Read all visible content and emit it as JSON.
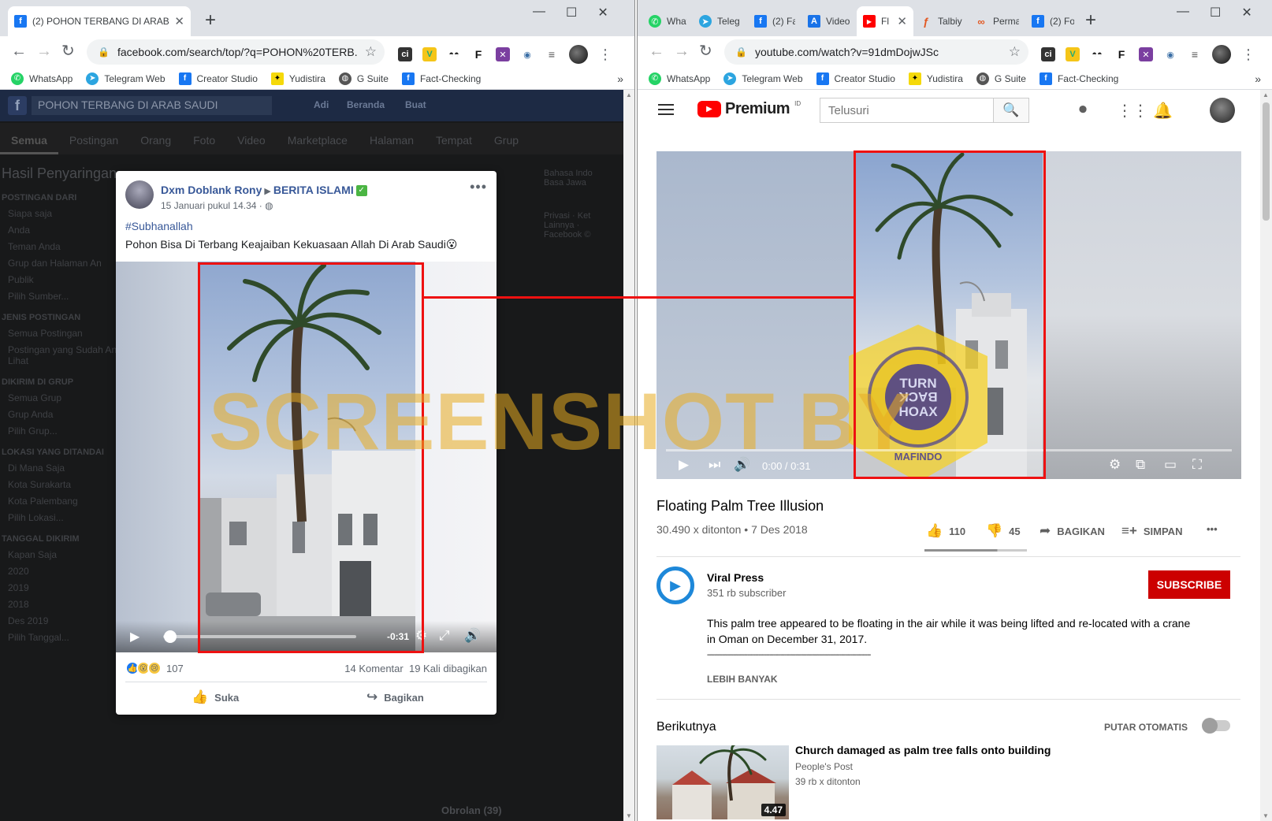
{
  "left_window": {
    "tab": {
      "title": "(2) POHON TERBANG DI ARAB SA"
    },
    "url": "facebook.com/search/top/?q=POHON%20TERB...",
    "extensions": [
      "ci",
      "V",
      "F"
    ],
    "bookmarks": [
      "WhatsApp",
      "Telegram Web",
      "Creator Studio",
      "Yudistira",
      "G Suite",
      "Fact-Checking"
    ],
    "bg": {
      "search": "POHON TERBANG DI ARAB SAUDI",
      "nav": [
        "Adi",
        "Beranda",
        "Buat"
      ],
      "filters": [
        "Semua",
        "Postingan",
        "Orang",
        "Foto",
        "Video",
        "Marketplace",
        "Halaman",
        "Tempat",
        "Grup"
      ],
      "sidebar_title": "Hasil Penyaringan",
      "sections": [
        {
          "title": "POSTINGAN DARI",
          "items": [
            "Siapa saja",
            "Anda",
            "Teman Anda",
            "Grup dan Halaman An",
            "Publik",
            "Pilih Sumber..."
          ]
        },
        {
          "title": "JENIS POSTINGAN",
          "items": [
            "Semua Postingan",
            "Postingan yang Sudah Anda Lihat"
          ]
        },
        {
          "title": "DIKIRIM DI GRUP",
          "items": [
            "Semua Grup",
            "Grup Anda",
            "Pilih Grup..."
          ]
        },
        {
          "title": "LOKASI YANG DITANDAI",
          "items": [
            "Di Mana Saja",
            "Kota Surakarta",
            "Kota Palembang",
            "Pilih Lokasi..."
          ]
        },
        {
          "title": "TANGGAL DIKIRIM",
          "items": [
            "Kapan Saja",
            "2020",
            "2019",
            "2018",
            "Des 2019",
            "Pilih Tanggal..."
          ]
        }
      ],
      "right_col": [
        "Bahasa Indo",
        "Basa Jawa",
        "Privasi · Ket",
        "Lainnya ·",
        "Facebook ©"
      ],
      "chat": "Obrolan (39)"
    },
    "post": {
      "author": "Dxm Doblank Rony",
      "group": "BERITA ISLAMI",
      "time": "15 Januari pukul 14.34 ·",
      "hashtag": "#Subhanallah",
      "text": "Pohon Bisa Di Terbang Keajaiban Kekuasaan Allah Di Arab Saudi😮",
      "video_time": "-0:31",
      "video_progress": 0.02,
      "reactions_count": "107",
      "comments": "14 Komentar",
      "shares": "19 Kali dibagikan",
      "like_label": "Suka",
      "share_label": "Bagikan"
    }
  },
  "right_window": {
    "tabs": [
      "What",
      "Teleg",
      "(2) Fa",
      "Video",
      "Fl",
      "Talbiy",
      "Perma",
      "(2) Fo"
    ],
    "url": "youtube.com/watch?v=91dmDojwJSc",
    "extensions": [
      "ci",
      "V",
      "F"
    ],
    "bookmarks": [
      "WhatsApp",
      "Telegram Web",
      "Creator Studio",
      "Yudistira",
      "G Suite",
      "Fact-Checking"
    ],
    "youtube": {
      "logo_text": "Premium",
      "region": "ID",
      "search_placeholder": "Telusuri",
      "video_time": "0:00 / 0:31",
      "video_progress": 0,
      "title": "Floating Palm Tree Illusion",
      "views": "30.490 x ditonton • 7 Des 2018",
      "likes": "110",
      "dislikes": "45",
      "share_label": "BAGIKAN",
      "save_label": "SIMPAN",
      "like_ratio": 0.71,
      "channel": "Viral Press",
      "subscribers": "351 rb subscriber",
      "subscribe_label": "SUBSCRIBE",
      "description": "This palm tree appeared to be floating in the air while it was being lifted and re-located with a crane in Oman on December 31, 2017.",
      "divider_text": "-----------------------------------------------------------------------------------------",
      "show_more": "LEBIH BANYAK",
      "up_next": "Berikutnya",
      "autoplay": "PUTAR OTOMATIS",
      "next_video": {
        "title": "Church damaged as palm tree falls onto building",
        "channel": "People's Post",
        "views": "39 rb x ditonton",
        "duration": "4.47"
      }
    }
  },
  "overlay": {
    "watermark": "SCREENSHOT BY",
    "stamp_text": [
      "TURN",
      "BACK",
      "HOAX",
      "MAFINDO"
    ],
    "highlight_color": "#ee1111"
  }
}
